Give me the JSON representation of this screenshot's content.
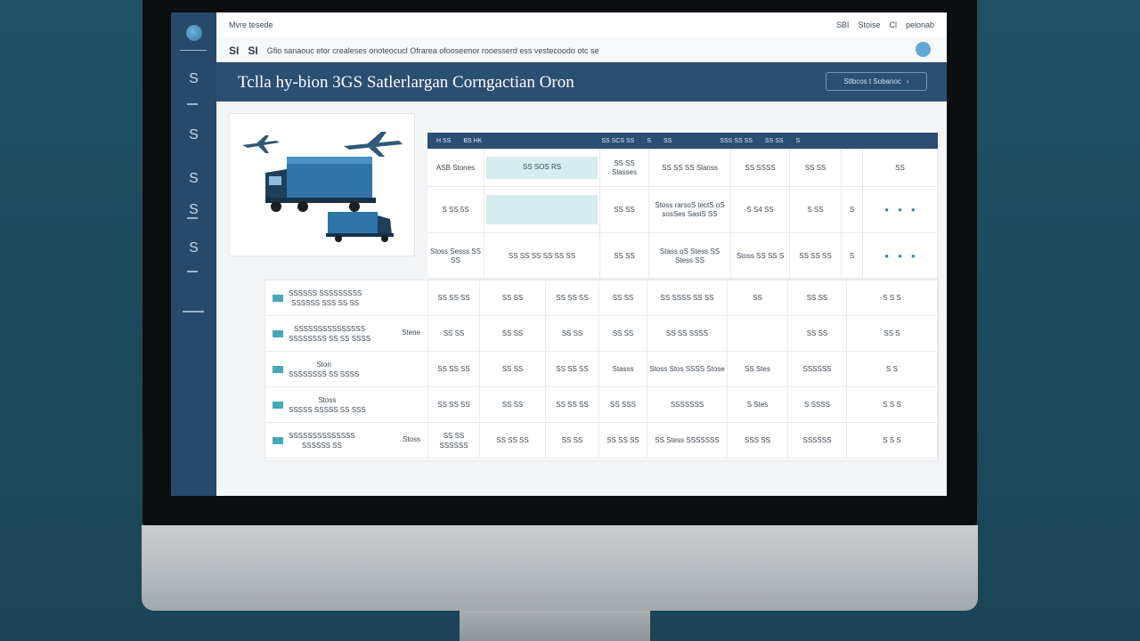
{
  "app": {
    "brand": "Mvre tesede",
    "top_links": [
      "SBI",
      "Stoise",
      "Cl",
      "pelonab"
    ],
    "breadcrumb_icon1": "SI",
    "breadcrumb_icon2": "SI",
    "breadcrumb_text": "Gfio sanaouc etor crealeses onoteocucl Ofrarea ofooseenor rooesserd ess vestecoodo otc se",
    "page_title": "Tclla hy-bion 3GS Satlerlargan Corngactian Oron",
    "header_button": "Stlbcos t Sobanoc"
  },
  "sidebar": {
    "items": [
      "S",
      "S",
      "S",
      "S",
      "S"
    ],
    "logo_icon": "globe-icon"
  },
  "table": {
    "head_labels": [
      "H SS",
      "BS HK",
      "SS SCS SS",
      "S",
      "SS",
      "SSS SS SS",
      "SS SS",
      "S"
    ],
    "col_headers": [
      "ASB Stones",
      "SS SOS RS",
      "SS SS Slasses",
      "SS SS SS Slanss",
      "SS SSSS",
      "SS SS",
      "SS"
    ],
    "rows": [
      [
        "S SS 5S",
        "",
        "SS SS",
        "Stoss rarsoS tectS oS sosSes SasiS SS",
        "S S4 SS",
        "S SS",
        "S"
      ],
      [
        "Stoss Sesss SS SS",
        "SS SS SS SS SS SS",
        "SS SS",
        "Stass oS Stess SS Stess SS",
        "Stoss SS SS S",
        "SS SS SS",
        "S"
      ]
    ]
  },
  "list": {
    "rows": [
      {
        "name": "SSSSSS SSSSSSSSS",
        "sub": "SSSSSS SSS SS SS",
        "badge": "",
        "c1": "SS SS SS",
        "c2": "SS SS",
        "c3": "SS SS SS",
        "c4": "SS SS",
        "c5": "SS SSSS SS SS",
        "c6": "SS",
        "c7": "SS SS",
        "c8": "S S S"
      },
      {
        "name": "SSSSSSSSSSSSSSS",
        "sub": "SSSSSSSS SS SS SSSS",
        "badge": "Stene",
        "c1": "SS SS",
        "c2": "SS SS",
        "c3": "SS SS",
        "c4": "SS SS",
        "c5": "SS SS SSSS",
        "c6": "",
        "c7": "SS SS",
        "c8": "SS S"
      },
      {
        "name": "Ston",
        "sub": "SSSSSSSS SS SSSS",
        "badge": "",
        "c1": "SS SS SS",
        "c2": "SS SS",
        "c3": "SS SS SS",
        "c4": "Stasss",
        "c5": "Stoss Stos SSSS Stose",
        "c6": "SS Stes",
        "c7": "SSSSSS",
        "c8": "S S"
      },
      {
        "name": "Stoss",
        "sub": "SSSSS SSSSS SS SSS",
        "badge": "",
        "c1": "SS SS SS",
        "c2": "SS SS",
        "c3": "SS SS SS",
        "c4": "SS SSS",
        "c5": "SSSSSSS",
        "c6": "S Stes",
        "c7": "S SSSS",
        "c8": "S S S"
      },
      {
        "name": "SSSSSSSSSSSSSS",
        "sub": "SSSSSS SS",
        "badge": "Stoss",
        "c1": "SS SS SSSSSS",
        "c2": "SS SS SS",
        "c3": "SS SS",
        "c4": "SS SS SS",
        "c5": "SS Stess SSSSSSS",
        "c6": "SSS SS",
        "c7": "SSSSSS",
        "c8": "S S S"
      }
    ]
  },
  "colors": {
    "accent": "#2b4e73",
    "teal": "#45a9b8",
    "sidebar": "#274a6a"
  }
}
